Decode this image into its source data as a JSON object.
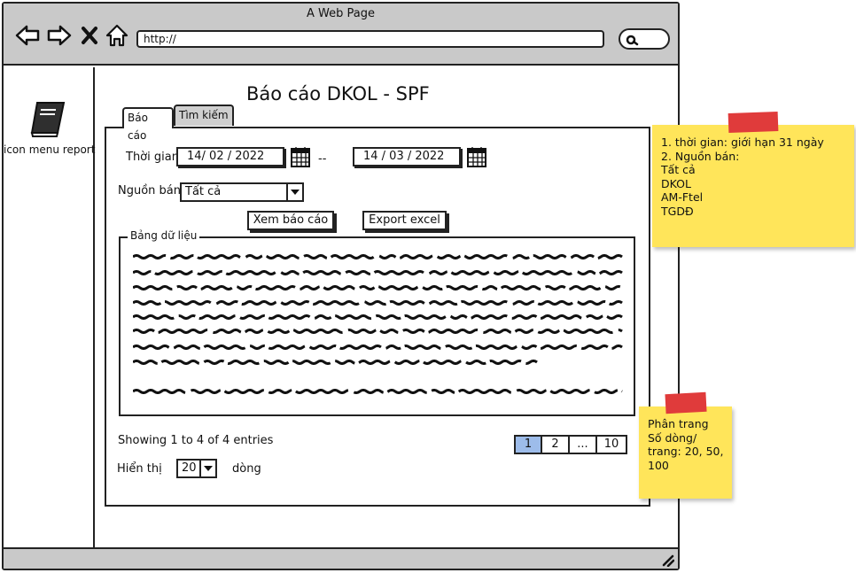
{
  "window": {
    "title": "A Web Page",
    "url": "http://"
  },
  "sidebar": {
    "items": [
      {
        "label": "icon menu report",
        "icon": "book-icon"
      }
    ]
  },
  "page": {
    "title": "Báo cáo DKOL - SPF"
  },
  "tabs": [
    {
      "label": "Báo cáo",
      "active": true
    },
    {
      "label": "Tìm kiếm",
      "active": false
    }
  ],
  "filters": {
    "time_label": "Thời gian",
    "date_from": "14/ 02 / 2022",
    "date_separator": "--",
    "date_to": "14 / 03 / 2022",
    "source_label": "Nguồn bán",
    "source_value": "Tất cả"
  },
  "actions": {
    "view_report": "Xem báo cáo",
    "export_excel": "Export excel"
  },
  "data_table": {
    "legend": "Bảng dữ liệu"
  },
  "footer": {
    "entries_info": "Showing 1 to 4 of 4 entries",
    "show_label": "Hiển thị",
    "page_size": "20",
    "rows_label": "dòng"
  },
  "pagination": {
    "pages": [
      "1",
      "2",
      "...",
      "10"
    ],
    "active": "1"
  },
  "notes": [
    {
      "lines": [
        "1. thời gian: giới hạn 31 ngày",
        "2. Nguồn bán:",
        "Tất cả",
        "DKOL",
        "AM-Ftel",
        "TGDĐ"
      ]
    },
    {
      "lines": [
        "Phân trang",
        "Số dòng/",
        "trang: 20, 50,",
        "100"
      ]
    }
  ],
  "colors": {
    "chrome": "#c9c9c9",
    "sticky": "#ffe55a",
    "tape": "#e03b3b",
    "active_page": "#9dbcea"
  }
}
